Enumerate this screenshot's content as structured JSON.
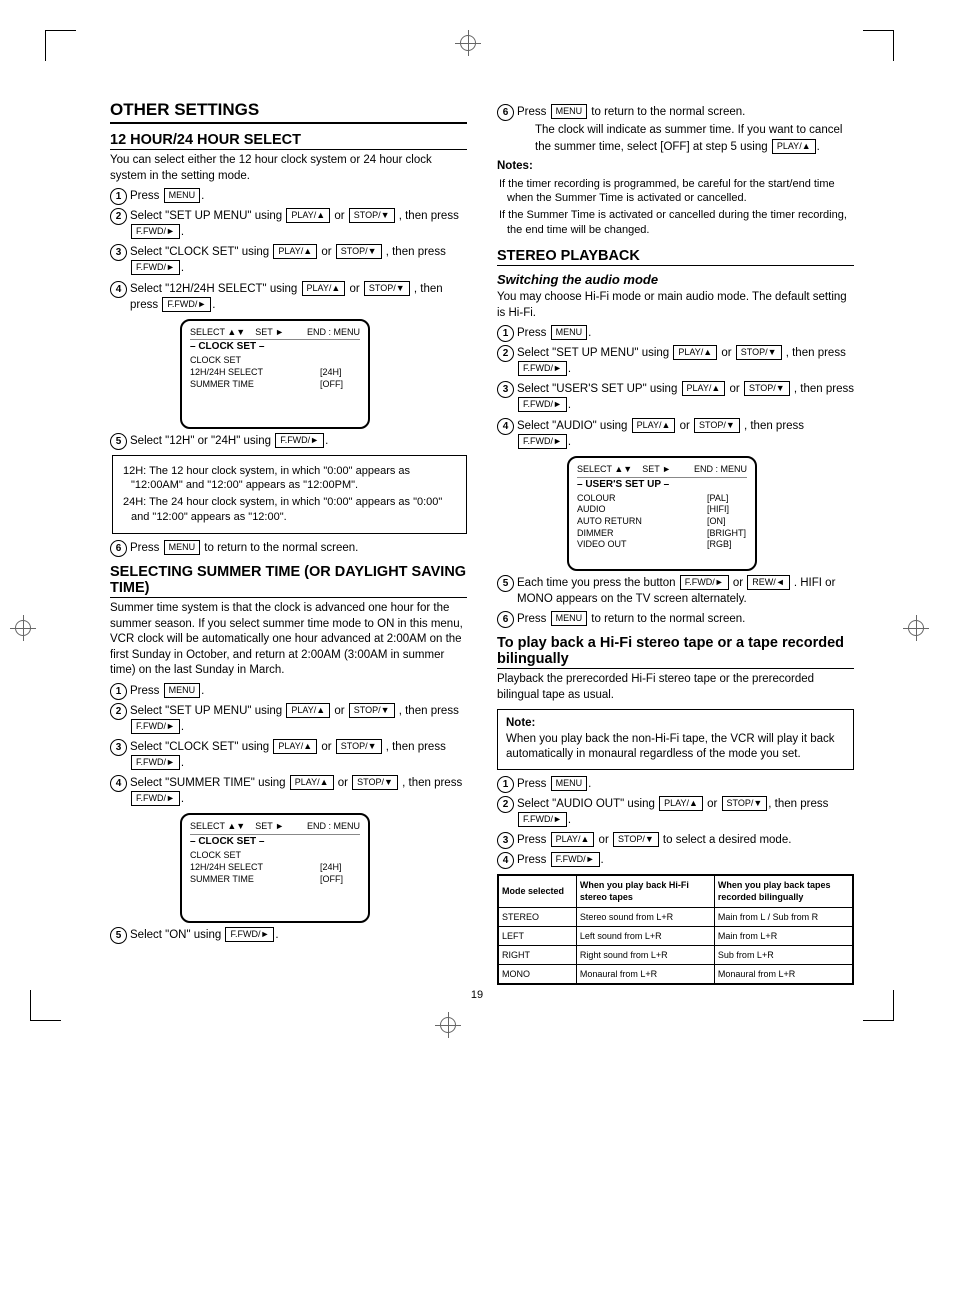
{
  "page_number": "19",
  "left": {
    "title1": "OTHER SETTINGS",
    "subtitle1": "12 HOUR/24 HOUR SELECT",
    "intro1": "You can select either the 12 hour clock system or 24 hour clock system in the setting mode.",
    "steps1": [
      {
        "text_a": "Press ",
        "key1": "MENU",
        "text_b": "."
      },
      {
        "text_a": "Select \"SET UP MENU\" using ",
        "key1": "PLAY/▲",
        "text_b": " or ",
        "key2": "STOP/▼",
        "text_c": " , then press ",
        "key3": "F.FWD/►",
        "text_d": "."
      },
      {
        "text_a": "Select \"CLOCK SET\" using ",
        "key1": "PLAY/▲",
        "text_b": " or ",
        "key2": "STOP/▼",
        "text_c": " , then press ",
        "key3": "F.FWD/►",
        "text_d": "."
      },
      {
        "text_a": "Select \"12H/24H SELECT\" using ",
        "key1": "PLAY/▲",
        "text_b": " or ",
        "key2": "STOP/▼",
        "text_c": " , then press ",
        "key3": "F.FWD/►",
        "text_d": "."
      }
    ],
    "tv1": {
      "head_left": "SELECT",
      "head_arrows": "▲▼",
      "head_set": "SET",
      "head_set_arrow": "►",
      "head_end": "END : MENU",
      "title": "– CLOCK SET –",
      "rows": [
        {
          "l": "CLOCK SET",
          "v": ""
        },
        {
          "l": "12H/24H SELECT",
          "v": "[24H]"
        },
        {
          "l": "SUMMER TIME",
          "v": "[OFF]"
        }
      ]
    },
    "step5a": {
      "pre": "Select \"12H\" or \"24H\" using ",
      "key1": "F.FWD/►",
      "post": "."
    },
    "box1": [
      "12H: The 12 hour clock system, in which \"0:00\" appears as \"12:00AM\" and \"12:00\" appears as \"12:00PM\".",
      "24H: The 24 hour clock system, in which \"0:00\" appears as \"0:00\" and \"12:00\" appears as \"12:00\"."
    ],
    "step6a": {
      "pre": "Press ",
      "key": "MENU",
      "post": " to return to the normal screen."
    },
    "subtitle2": "SELECTING SUMMER TIME (OR DAYLIGHT SAVING TIME)",
    "intro2": "Summer time system is that the clock is advanced one hour for the summer season. If you select summer time mode to ON in this menu, VCR clock will be automatically one hour advanced at 2:00AM on the first Sunday in October, and return at 2:00AM (3:00AM in summer time) on the last Sunday in March.",
    "steps2": [
      {
        "text_a": "Press ",
        "key1": "MENU",
        "text_b": "."
      },
      {
        "text_a": "Select \"SET UP MENU\" using ",
        "key1": "PLAY/▲",
        "text_b": " or ",
        "key2": "STOP/▼",
        "text_c": " , then press ",
        "key3": "F.FWD/►",
        "text_d": "."
      },
      {
        "text_a": "Select \"CLOCK SET\" using ",
        "key1": "PLAY/▲",
        "text_b": " or ",
        "key2": "STOP/▼",
        "text_c": " , then press ",
        "key3": "F.FWD/►",
        "text_d": "."
      },
      {
        "text_a": "Select \"SUMMER TIME\" using ",
        "key1": "PLAY/▲",
        "text_b": " or ",
        "key2": "STOP/▼",
        "text_c": " , then press ",
        "key3": "F.FWD/►",
        "text_d": "."
      }
    ],
    "tv2": {
      "head_left": "SELECT",
      "head_arrows": "▲▼",
      "head_set": "SET",
      "head_set_arrow": "►",
      "head_end": "END : MENU",
      "title": "– CLOCK SET –",
      "rows": [
        {
          "l": "CLOCK SET",
          "v": ""
        },
        {
          "l": "12H/24H SELECT",
          "v": "[24H]"
        },
        {
          "l": "SUMMER TIME",
          "v": "[OFF]"
        }
      ]
    },
    "step5b": {
      "pre": "Select \"ON\" using ",
      "key": "F.FWD/►",
      "post": "."
    }
  },
  "right": {
    "step6b": {
      "pre": "Press ",
      "key": "MENU",
      "post": " to return to the normal screen."
    },
    "step6b_sub1": {
      "pre": "The clock will indicate as summer time. If you want to cancel the summer time, select [OFF] at step 5 using ",
      "key": "PLAY/▲",
      "post": "."
    },
    "notes_heading": "Notes:",
    "notes": [
      "If the timer recording is programmed, be careful for the start/end time when the Summer Time is activated or cancelled.",
      "If the Summer Time is activated or cancelled during the timer recording, the end time will be changed."
    ],
    "subtitle3": "STEREO PLAYBACK",
    "sub3_h1": "Switching the audio mode",
    "intro3": "You may choose Hi-Fi mode or main audio mode. The default setting is Hi-Fi.",
    "steps3": [
      {
        "text_a": "Press ",
        "key1": "MENU",
        "text_b": "."
      },
      {
        "text_a": "Select \"SET UP MENU\" using ",
        "key1": "PLAY/▲",
        "text_b": " or ",
        "key2": "STOP/▼",
        "text_c": " , then press ",
        "key3": "F.FWD/►",
        "text_d": "."
      },
      {
        "text_a": "Select \"USER'S SET UP\" using ",
        "key1": "PLAY/▲",
        "text_b": " or ",
        "key2": "STOP/▼",
        "text_c": " , then press ",
        "key3": "F.FWD/►",
        "text_d": "."
      },
      {
        "text_a": "Select \"AUDIO\" using ",
        "key1": "PLAY/▲",
        "text_b": " or ",
        "key2": "STOP/▼",
        "text_c": " , then press ",
        "key3": "F.FWD/►",
        "text_d": "."
      }
    ],
    "tv3": {
      "head_left": "SELECT",
      "head_arrows": "▲▼",
      "head_set": "SET",
      "head_set_arrow": "►",
      "head_end": "END : MENU",
      "title": "– USER'S SET UP –",
      "rows": [
        {
          "l": "COLOUR",
          "v": "[PAL]"
        },
        {
          "l": "AUDIO",
          "v": "[HIFI]"
        },
        {
          "l": "AUTO RETURN",
          "v": "[ON]"
        },
        {
          "l": "DIMMER",
          "v": "[BRIGHT]"
        },
        {
          "l": "VIDEO OUT",
          "v": "[RGB]"
        }
      ]
    },
    "step5c": {
      "pre": "Each time you press the button ",
      "key": "F.FWD/►",
      "post": " or",
      "key2": "REW/◄",
      "post2": " . HIFI or MONO appears on the TV screen alternately."
    },
    "step6c": {
      "pre": "Press ",
      "key": "MENU",
      "post": " to return to the normal screen."
    },
    "subtitle4": "To play back a Hi-Fi stereo tape or a tape recorded bilingually",
    "intro4": "Playback the prerecorded Hi-Fi stereo tape or the prerecorded bilingual tape as usual.",
    "box2_heading": "Note:",
    "box2_text": "When you play back the non-Hi-Fi tape, the VCR will play it back automatically in monaural regardless of the mode you set.",
    "steps4": [
      {
        "text_a": "Press ",
        "key1": "MENU",
        "text_b": "."
      },
      {
        "text_a": "Select \"AUDIO OUT\" using ",
        "key1": "PLAY/▲",
        "text_b": " or ",
        "key2": "STOP/▼",
        "text_c": ", then press ",
        "key3": "F.FWD/►",
        "text_d": "."
      },
      {
        "text_a": "Press ",
        "key1": "PLAY/▲",
        "text_b": " or ",
        "key2": "STOP/▼",
        "text_c": " to select a desired mode."
      },
      {
        "text_a": "Press ",
        "key1": "F.FWD/►",
        "text_b": "."
      }
    ],
    "box3_rows": [
      {
        "mode": "STEREO",
        "hifi": "Stereo sound from L+R",
        "bi": "Main from L / Sub from R"
      },
      {
        "mode": "LEFT",
        "hifi": "Left sound from L+R",
        "bi": "Main from L+R"
      },
      {
        "mode": "RIGHT",
        "hifi": "Right sound from L+R",
        "bi": "Sub from L+R"
      },
      {
        "mode": "MONO",
        "hifi": "Monaural from L+R",
        "bi": "Monaural from L+R"
      }
    ],
    "box3_head": {
      "c1": "Mode selected",
      "c2": "When you play back Hi-Fi stereo tapes",
      "c3": "When you play back tapes recorded bilingually"
    }
  }
}
